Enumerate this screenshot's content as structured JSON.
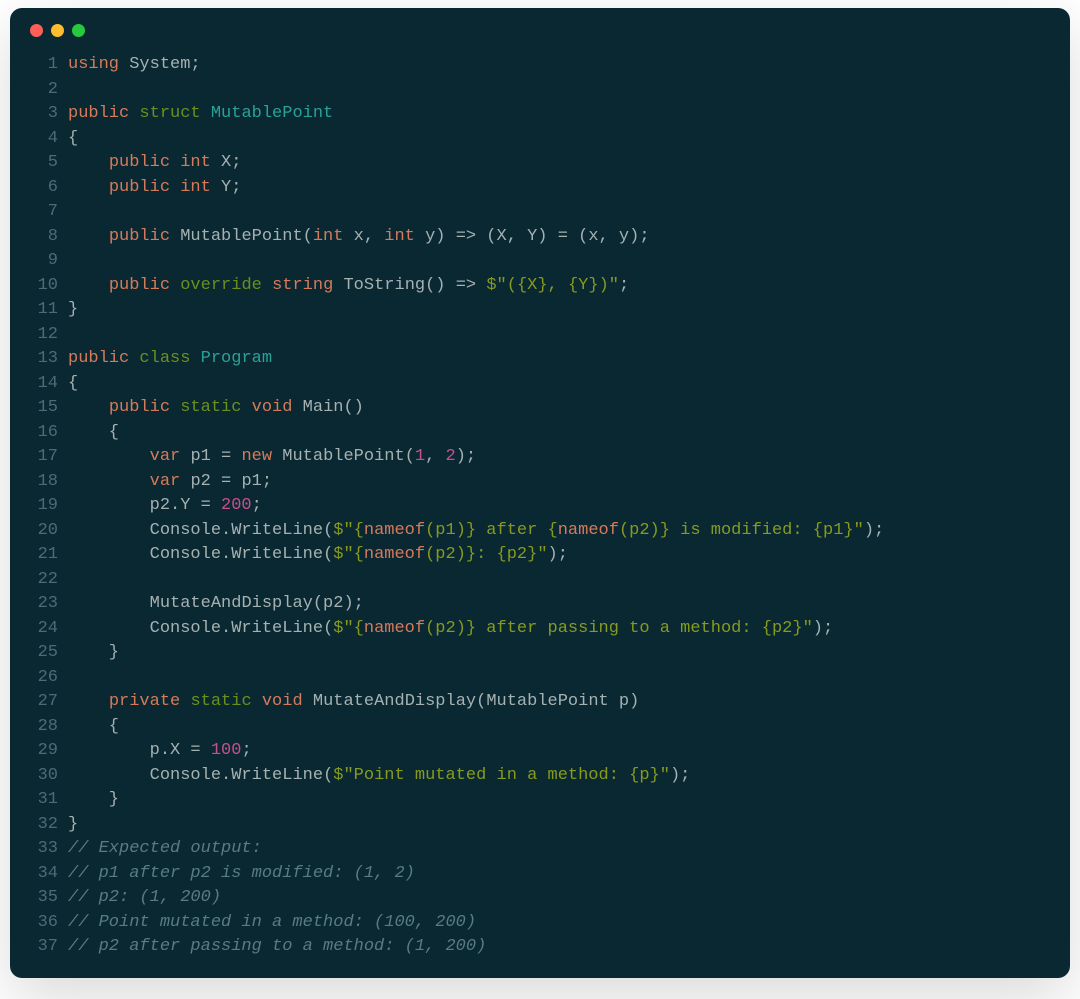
{
  "traffic_lights": [
    "red",
    "yellow",
    "green"
  ],
  "code_lines": [
    {
      "n": "1",
      "tokens": [
        {
          "t": "using ",
          "c": "kw"
        },
        {
          "t": "System;",
          "c": "pln"
        }
      ]
    },
    {
      "n": "2",
      "tokens": []
    },
    {
      "n": "3",
      "tokens": [
        {
          "t": "public ",
          "c": "kw"
        },
        {
          "t": "struct ",
          "c": "kw2"
        },
        {
          "t": "MutablePoint",
          "c": "typ"
        }
      ]
    },
    {
      "n": "4",
      "tokens": [
        {
          "t": "{",
          "c": "pln"
        }
      ]
    },
    {
      "n": "5",
      "tokens": [
        {
          "t": "    ",
          "c": "pln"
        },
        {
          "t": "public ",
          "c": "kw"
        },
        {
          "t": "int ",
          "c": "kw"
        },
        {
          "t": "X;",
          "c": "pln"
        }
      ]
    },
    {
      "n": "6",
      "tokens": [
        {
          "t": "    ",
          "c": "pln"
        },
        {
          "t": "public ",
          "c": "kw"
        },
        {
          "t": "int ",
          "c": "kw"
        },
        {
          "t": "Y;",
          "c": "pln"
        }
      ]
    },
    {
      "n": "7",
      "tokens": []
    },
    {
      "n": "8",
      "tokens": [
        {
          "t": "    ",
          "c": "pln"
        },
        {
          "t": "public ",
          "c": "kw"
        },
        {
          "t": "MutablePoint",
          "c": "fn"
        },
        {
          "t": "(",
          "c": "pln"
        },
        {
          "t": "int ",
          "c": "kw"
        },
        {
          "t": "x, ",
          "c": "pln"
        },
        {
          "t": "int ",
          "c": "kw"
        },
        {
          "t": "y) => (X, Y) = (x, y);",
          "c": "pln"
        }
      ]
    },
    {
      "n": "9",
      "tokens": []
    },
    {
      "n": "10",
      "tokens": [
        {
          "t": "    ",
          "c": "pln"
        },
        {
          "t": "public ",
          "c": "kw"
        },
        {
          "t": "override ",
          "c": "kw2"
        },
        {
          "t": "string ",
          "c": "kw"
        },
        {
          "t": "ToString",
          "c": "fn"
        },
        {
          "t": "() => ",
          "c": "pln"
        },
        {
          "t": "$\"(",
          "c": "str"
        },
        {
          "t": "{X}",
          "c": "str"
        },
        {
          "t": ", ",
          "c": "str"
        },
        {
          "t": "{Y}",
          "c": "str"
        },
        {
          "t": ")\"",
          "c": "str"
        },
        {
          "t": ";",
          "c": "pln"
        }
      ]
    },
    {
      "n": "11",
      "tokens": [
        {
          "t": "}",
          "c": "pln"
        }
      ]
    },
    {
      "n": "12",
      "tokens": []
    },
    {
      "n": "13",
      "tokens": [
        {
          "t": "public ",
          "c": "kw"
        },
        {
          "t": "class ",
          "c": "kw2"
        },
        {
          "t": "Program",
          "c": "typ"
        }
      ]
    },
    {
      "n": "14",
      "tokens": [
        {
          "t": "{",
          "c": "pln"
        }
      ]
    },
    {
      "n": "15",
      "tokens": [
        {
          "t": "    ",
          "c": "pln"
        },
        {
          "t": "public ",
          "c": "kw"
        },
        {
          "t": "static ",
          "c": "kw2"
        },
        {
          "t": "void ",
          "c": "kw"
        },
        {
          "t": "Main",
          "c": "fn"
        },
        {
          "t": "()",
          "c": "pln"
        }
      ]
    },
    {
      "n": "16",
      "tokens": [
        {
          "t": "    {",
          "c": "pln"
        }
      ]
    },
    {
      "n": "17",
      "tokens": [
        {
          "t": "        ",
          "c": "pln"
        },
        {
          "t": "var ",
          "c": "kw"
        },
        {
          "t": "p1 = ",
          "c": "pln"
        },
        {
          "t": "new ",
          "c": "kw"
        },
        {
          "t": "MutablePoint",
          "c": "fn"
        },
        {
          "t": "(",
          "c": "pln"
        },
        {
          "t": "1",
          "c": "num"
        },
        {
          "t": ", ",
          "c": "pln"
        },
        {
          "t": "2",
          "c": "num"
        },
        {
          "t": ");",
          "c": "pln"
        }
      ]
    },
    {
      "n": "18",
      "tokens": [
        {
          "t": "        ",
          "c": "pln"
        },
        {
          "t": "var ",
          "c": "kw"
        },
        {
          "t": "p2 = p1;",
          "c": "pln"
        }
      ]
    },
    {
      "n": "19",
      "tokens": [
        {
          "t": "        p2.Y = ",
          "c": "pln"
        },
        {
          "t": "200",
          "c": "num"
        },
        {
          "t": ";",
          "c": "pln"
        }
      ]
    },
    {
      "n": "20",
      "tokens": [
        {
          "t": "        Console.",
          "c": "pln"
        },
        {
          "t": "WriteLine",
          "c": "fn"
        },
        {
          "t": "(",
          "c": "pln"
        },
        {
          "t": "$\"",
          "c": "str"
        },
        {
          "t": "{",
          "c": "str"
        },
        {
          "t": "nameof",
          "c": "kw"
        },
        {
          "t": "(p1)}",
          "c": "str"
        },
        {
          "t": " after ",
          "c": "str"
        },
        {
          "t": "{",
          "c": "str"
        },
        {
          "t": "nameof",
          "c": "kw"
        },
        {
          "t": "(p2)}",
          "c": "str"
        },
        {
          "t": " is modified: ",
          "c": "str"
        },
        {
          "t": "{p1}",
          "c": "str"
        },
        {
          "t": "\"",
          "c": "str"
        },
        {
          "t": ");",
          "c": "pln"
        }
      ]
    },
    {
      "n": "21",
      "tokens": [
        {
          "t": "        Console.",
          "c": "pln"
        },
        {
          "t": "WriteLine",
          "c": "fn"
        },
        {
          "t": "(",
          "c": "pln"
        },
        {
          "t": "$\"",
          "c": "str"
        },
        {
          "t": "{",
          "c": "str"
        },
        {
          "t": "nameof",
          "c": "kw"
        },
        {
          "t": "(p2)}",
          "c": "str"
        },
        {
          "t": ": ",
          "c": "str"
        },
        {
          "t": "{p2}",
          "c": "str"
        },
        {
          "t": "\"",
          "c": "str"
        },
        {
          "t": ");",
          "c": "pln"
        }
      ]
    },
    {
      "n": "22",
      "tokens": []
    },
    {
      "n": "23",
      "tokens": [
        {
          "t": "        ",
          "c": "pln"
        },
        {
          "t": "MutateAndDisplay",
          "c": "fn"
        },
        {
          "t": "(p2);",
          "c": "pln"
        }
      ]
    },
    {
      "n": "24",
      "tokens": [
        {
          "t": "        Console.",
          "c": "pln"
        },
        {
          "t": "WriteLine",
          "c": "fn"
        },
        {
          "t": "(",
          "c": "pln"
        },
        {
          "t": "$\"",
          "c": "str"
        },
        {
          "t": "{",
          "c": "str"
        },
        {
          "t": "nameof",
          "c": "kw"
        },
        {
          "t": "(p2)}",
          "c": "str"
        },
        {
          "t": " after passing to a method: ",
          "c": "str"
        },
        {
          "t": "{p2}",
          "c": "str"
        },
        {
          "t": "\"",
          "c": "str"
        },
        {
          "t": ");",
          "c": "pln"
        }
      ]
    },
    {
      "n": "25",
      "tokens": [
        {
          "t": "    }",
          "c": "pln"
        }
      ]
    },
    {
      "n": "26",
      "tokens": []
    },
    {
      "n": "27",
      "tokens": [
        {
          "t": "    ",
          "c": "pln"
        },
        {
          "t": "private ",
          "c": "kw"
        },
        {
          "t": "static ",
          "c": "kw2"
        },
        {
          "t": "void ",
          "c": "kw"
        },
        {
          "t": "MutateAndDisplay",
          "c": "fn"
        },
        {
          "t": "(",
          "c": "pln"
        },
        {
          "t": "MutablePoint",
          "c": "fn"
        },
        {
          "t": " p)",
          "c": "pln"
        }
      ]
    },
    {
      "n": "28",
      "tokens": [
        {
          "t": "    {",
          "c": "pln"
        }
      ]
    },
    {
      "n": "29",
      "tokens": [
        {
          "t": "        p.X = ",
          "c": "pln"
        },
        {
          "t": "100",
          "c": "num"
        },
        {
          "t": ";",
          "c": "pln"
        }
      ]
    },
    {
      "n": "30",
      "tokens": [
        {
          "t": "        Console.",
          "c": "pln"
        },
        {
          "t": "WriteLine",
          "c": "fn"
        },
        {
          "t": "(",
          "c": "pln"
        },
        {
          "t": "$\"Point mutated in a method: ",
          "c": "str"
        },
        {
          "t": "{p}",
          "c": "str"
        },
        {
          "t": "\"",
          "c": "str"
        },
        {
          "t": ");",
          "c": "pln"
        }
      ]
    },
    {
      "n": "31",
      "tokens": [
        {
          "t": "    }",
          "c": "pln"
        }
      ]
    },
    {
      "n": "32",
      "tokens": [
        {
          "t": "}",
          "c": "pln"
        }
      ]
    },
    {
      "n": "33",
      "tokens": [
        {
          "t": "// Expected output:",
          "c": "cmt"
        }
      ]
    },
    {
      "n": "34",
      "tokens": [
        {
          "t": "// p1 after p2 is modified: (1, 2)",
          "c": "cmt"
        }
      ]
    },
    {
      "n": "35",
      "tokens": [
        {
          "t": "// p2: (1, 200)",
          "c": "cmt"
        }
      ]
    },
    {
      "n": "36",
      "tokens": [
        {
          "t": "// Point mutated in a method: (100, 200)",
          "c": "cmt"
        }
      ]
    },
    {
      "n": "37",
      "tokens": [
        {
          "t": "// p2 after passing to a method: (1, 200)",
          "c": "cmt"
        }
      ]
    }
  ]
}
